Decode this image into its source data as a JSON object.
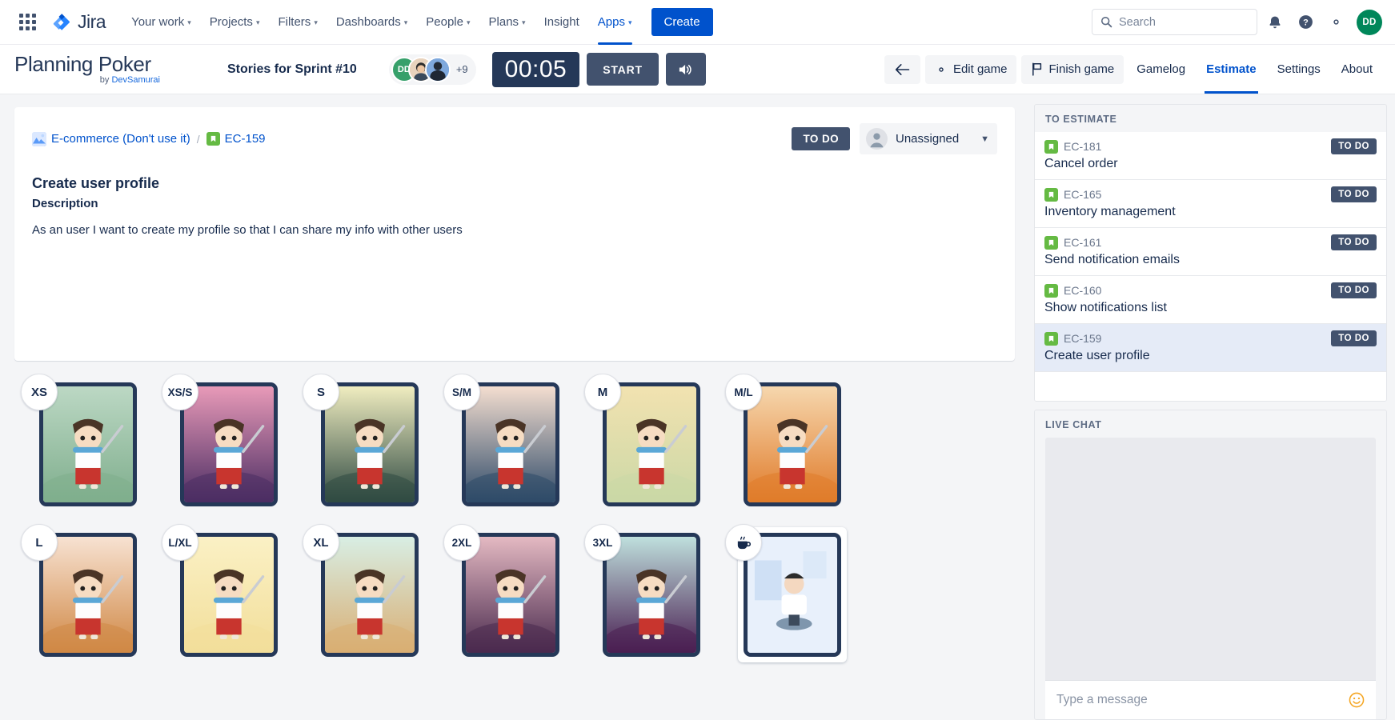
{
  "jira_nav": {
    "logo_text": "Jira",
    "items": [
      {
        "label": "Your work",
        "has_caret": true,
        "active": false
      },
      {
        "label": "Projects",
        "has_caret": true,
        "active": false
      },
      {
        "label": "Filters",
        "has_caret": true,
        "active": false
      },
      {
        "label": "Dashboards",
        "has_caret": true,
        "active": false
      },
      {
        "label": "People",
        "has_caret": true,
        "active": false
      },
      {
        "label": "Plans",
        "has_caret": true,
        "active": false
      },
      {
        "label": "Insight",
        "has_caret": false,
        "active": false
      },
      {
        "label": "Apps",
        "has_caret": true,
        "active": true
      }
    ],
    "create_label": "Create",
    "search_placeholder": "Search",
    "search_value": "",
    "icons": [
      "notifications-icon",
      "help-icon",
      "settings-icon"
    ],
    "user_avatar_initials": "DD",
    "user_avatar_color": "#00875a"
  },
  "pp_header": {
    "brand_title": "Planning Poker",
    "brand_by_prefix": "by ",
    "brand_by_name": "DevSamurai",
    "sprint_title": "Stories for Sprint #10",
    "players_overflow": "+9",
    "players": [
      {
        "initials": "DD",
        "color": "#36a06a"
      },
      {
        "initials": "",
        "color": "#f0c7a0"
      },
      {
        "initials": "",
        "color": "#5b8dd6"
      }
    ],
    "timer": "00:05",
    "start_label": "START",
    "sound_label": "sound-on-icon",
    "back_label": "back-arrow-icon",
    "edit_game_label": "Edit game",
    "finish_game_label": "Finish game",
    "tabs": [
      {
        "label": "Gamelog",
        "active": false
      },
      {
        "label": "Estimate",
        "active": true
      },
      {
        "label": "Settings",
        "active": false
      },
      {
        "label": "About",
        "active": false
      }
    ]
  },
  "story": {
    "project_name": "E-commerce (Don't use it)",
    "separator": "/",
    "issue_key": "EC-159",
    "status": "TO DO",
    "assignee": "Unassigned",
    "title": "Create user profile",
    "description_label": "Description",
    "description": "As an user I want to create my profile so that I can share my info with other users"
  },
  "cards": [
    {
      "label": "XS",
      "type": "text",
      "bg1": "#bcd8c4",
      "bg2": "#7fae8d",
      "selected": false
    },
    {
      "label": "XS/S",
      "type": "text",
      "bg1": "#e89ab8",
      "bg2": "#4b2d63",
      "selected": false
    },
    {
      "label": "S",
      "type": "text",
      "bg1": "#f0edc0",
      "bg2": "#2f4a42",
      "selected": false
    },
    {
      "label": "S/M",
      "type": "text",
      "bg1": "#f4ded0",
      "bg2": "#2e4a68",
      "selected": false
    },
    {
      "label": "M",
      "type": "text",
      "bg1": "#f2e2b0",
      "bg2": "#cbd8a6",
      "selected": false
    },
    {
      "label": "M/L",
      "type": "text",
      "bg1": "#f6d7ae",
      "bg2": "#e07b2a",
      "selected": false
    },
    {
      "label": "L",
      "type": "text",
      "bg1": "#f7e2d2",
      "bg2": "#d08845",
      "selected": false
    },
    {
      "label": "L/XL",
      "type": "text",
      "bg1": "#fbf1c5",
      "bg2": "#f2de9a",
      "selected": false
    },
    {
      "label": "XL",
      "type": "text",
      "bg1": "#d8eee4",
      "bg2": "#d9ae73",
      "selected": false
    },
    {
      "label": "2XL",
      "type": "text",
      "bg1": "#e4b9c2",
      "bg2": "#4a2a4e",
      "selected": false
    },
    {
      "label": "3XL",
      "type": "text",
      "bg1": "#bfe0dd",
      "bg2": "#4a1f52",
      "selected": false
    },
    {
      "label": "coffee-icon",
      "type": "icon",
      "bg1": "#e8f0fb",
      "bg2": "#cfe0f5",
      "selected": true
    }
  ],
  "to_estimate": {
    "panel_title": "TO ESTIMATE",
    "items": [
      {
        "key": "EC-181",
        "summary": "Cancel order",
        "status": "TO DO",
        "active": false
      },
      {
        "key": "EC-165",
        "summary": "Inventory management",
        "status": "TO DO",
        "active": false
      },
      {
        "key": "EC-161",
        "summary": "Send notification emails",
        "status": "TO DO",
        "active": false
      },
      {
        "key": "EC-160",
        "summary": "Show notifications list",
        "status": "TO DO",
        "active": false
      },
      {
        "key": "EC-159",
        "summary": "Create user profile",
        "status": "TO DO",
        "active": true
      }
    ]
  },
  "live_chat": {
    "panel_title": "LIVE CHAT",
    "input_placeholder": "Type a message",
    "input_value": "",
    "emoji_icon": "emoji-smiley-icon"
  },
  "colors": {
    "brand_blue": "#0052cc",
    "dark_navy": "#253858",
    "status_grey": "#42526e",
    "story_green": "#65ba43",
    "selected_row": "#e5ebf7"
  }
}
